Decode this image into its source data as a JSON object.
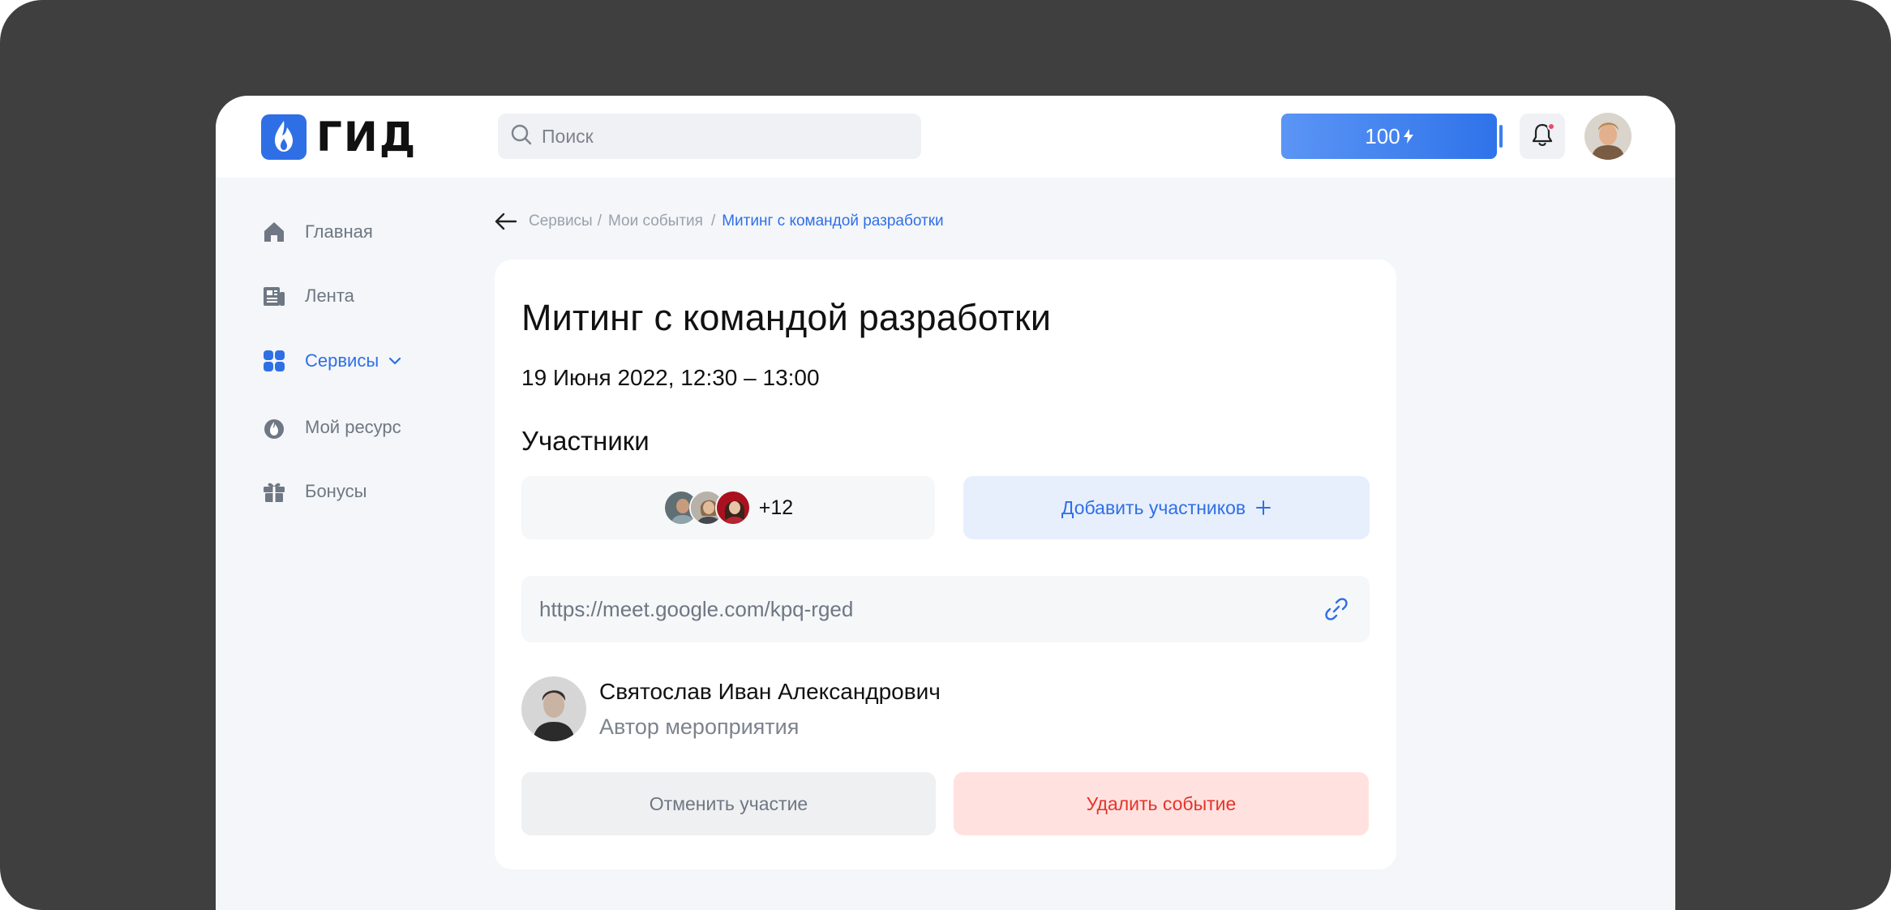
{
  "app": {
    "logo_text": "ГИД",
    "search_placeholder": "Поиск",
    "balance": "100",
    "balance_icon": "lightning-icon",
    "accent_color": "#2f6fe6"
  },
  "sidebar": {
    "items": [
      {
        "label": "Главная",
        "icon": "home-icon",
        "active": false
      },
      {
        "label": "Лента",
        "icon": "news-icon",
        "active": false
      },
      {
        "label": "Сервисы",
        "icon": "grid-icon",
        "active": true
      },
      {
        "label": "Мой ресурс",
        "icon": "flame-icon",
        "active": false
      },
      {
        "label": "Бонусы",
        "icon": "gift-icon",
        "active": false
      }
    ]
  },
  "breadcrumb": {
    "items": [
      "Сервисы",
      "Мои события",
      "Митинг с командой разработки"
    ]
  },
  "event": {
    "title": "Митинг с командой разработки",
    "datetime": "19 Июня 2022, 12:30 – 13:00",
    "participants_heading": "Участники",
    "participants_more": "+12",
    "add_participants_label": "Добавить участников",
    "meeting_url": "https://meet.google.com/kpq-rged",
    "author_name": "Святослав Иван Александрович",
    "author_role": "Автор мероприятия",
    "cancel_label": "Отменить участие",
    "delete_label": "Удалить событие"
  }
}
